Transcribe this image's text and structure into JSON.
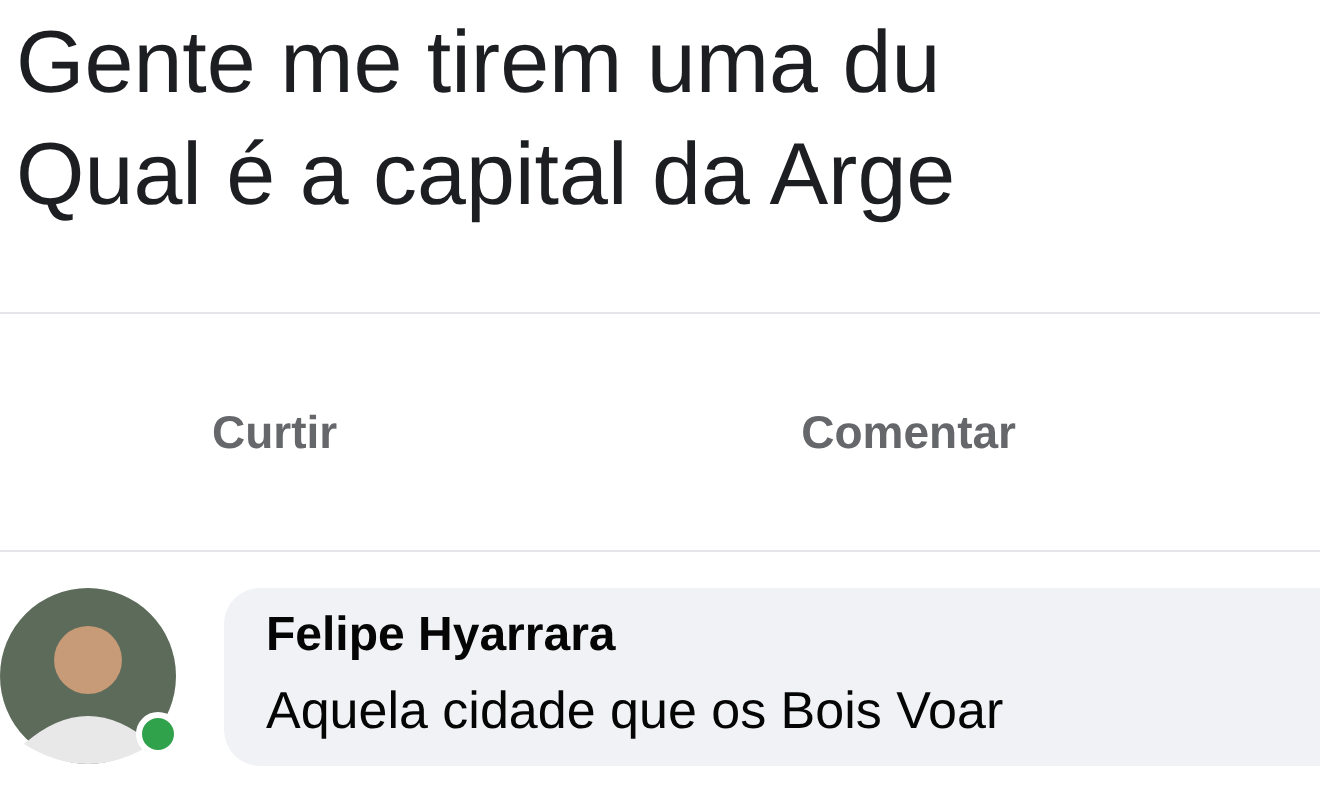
{
  "post": {
    "lines": [
      "Gente me tirem uma du",
      "Qual é a capital da Arge"
    ]
  },
  "actions": [
    "Curtir",
    "Comentar"
  ],
  "comment": {
    "author": "Felipe Hyarrara",
    "text": "Aquela cidade que os Bois Voar",
    "online": true
  }
}
